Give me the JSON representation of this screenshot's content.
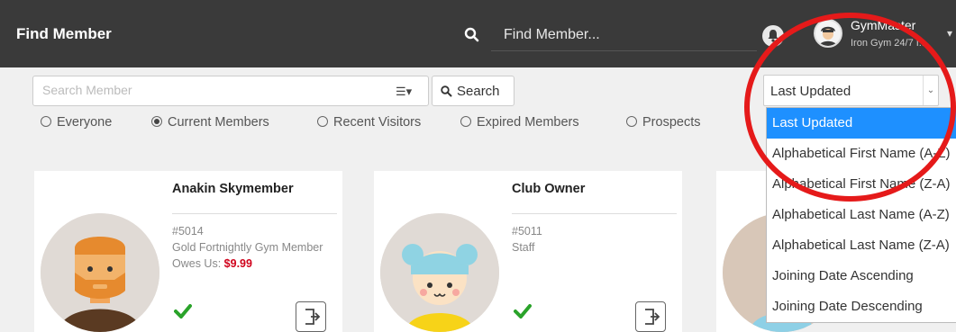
{
  "header": {
    "title": "Find Member",
    "search_placeholder": "Find Member...",
    "user_name": "GymMaster",
    "user_gym": "Iron Gym 24/7 I..."
  },
  "search": {
    "placeholder": "Search Member",
    "button_label": "Search"
  },
  "filters": [
    {
      "label": "Everyone",
      "selected": false
    },
    {
      "label": "Current Members",
      "selected": true
    },
    {
      "label": "Recent Visitors",
      "selected": false
    },
    {
      "label": "Expired Members",
      "selected": false
    },
    {
      "label": "Prospects",
      "selected": false
    }
  ],
  "sort": {
    "selected": "Last Updated",
    "options": [
      "Last Updated",
      "Alphabetical First Name (A-Z)",
      "Alphabetical First Name (Z-A)",
      "Alphabetical Last Name (A-Z)",
      "Alphabetical Last Name (Z-A)",
      "Joining Date Ascending",
      "Joining Date Descending"
    ]
  },
  "members": [
    {
      "name": "Anakin Skymember",
      "number": "#5014",
      "plan": "Gold Fortnightly Gym Member",
      "owes_label": "Owes Us:",
      "owes_amount": "$9.99"
    },
    {
      "name": "Club Owner",
      "number": "#5011",
      "plan": "Staff",
      "owes_label": "",
      "owes_amount": ""
    }
  ],
  "colors": {
    "topbar": "#3a3a3a",
    "dropdown_active": "#1e90ff",
    "annotation_circle": "#e51a1a",
    "owes": "#d0021b",
    "check": "#2aa32a"
  }
}
